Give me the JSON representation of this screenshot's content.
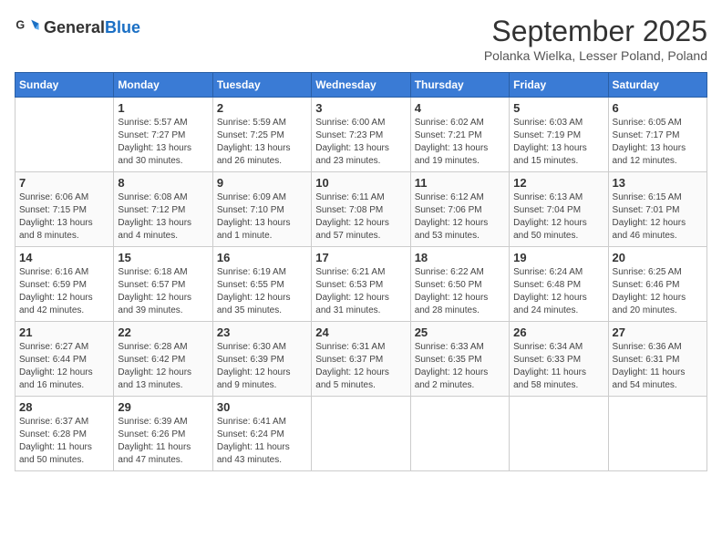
{
  "header": {
    "logo_general": "General",
    "logo_blue": "Blue",
    "month_title": "September 2025",
    "subtitle": "Polanka Wielka, Lesser Poland, Poland"
  },
  "days_of_week": [
    "Sunday",
    "Monday",
    "Tuesday",
    "Wednesday",
    "Thursday",
    "Friday",
    "Saturday"
  ],
  "weeks": [
    [
      {
        "day": "",
        "info": ""
      },
      {
        "day": "1",
        "info": "Sunrise: 5:57 AM\nSunset: 7:27 PM\nDaylight: 13 hours\nand 30 minutes."
      },
      {
        "day": "2",
        "info": "Sunrise: 5:59 AM\nSunset: 7:25 PM\nDaylight: 13 hours\nand 26 minutes."
      },
      {
        "day": "3",
        "info": "Sunrise: 6:00 AM\nSunset: 7:23 PM\nDaylight: 13 hours\nand 23 minutes."
      },
      {
        "day": "4",
        "info": "Sunrise: 6:02 AM\nSunset: 7:21 PM\nDaylight: 13 hours\nand 19 minutes."
      },
      {
        "day": "5",
        "info": "Sunrise: 6:03 AM\nSunset: 7:19 PM\nDaylight: 13 hours\nand 15 minutes."
      },
      {
        "day": "6",
        "info": "Sunrise: 6:05 AM\nSunset: 7:17 PM\nDaylight: 13 hours\nand 12 minutes."
      }
    ],
    [
      {
        "day": "7",
        "info": "Sunrise: 6:06 AM\nSunset: 7:15 PM\nDaylight: 13 hours\nand 8 minutes."
      },
      {
        "day": "8",
        "info": "Sunrise: 6:08 AM\nSunset: 7:12 PM\nDaylight: 13 hours\nand 4 minutes."
      },
      {
        "day": "9",
        "info": "Sunrise: 6:09 AM\nSunset: 7:10 PM\nDaylight: 13 hours\nand 1 minute."
      },
      {
        "day": "10",
        "info": "Sunrise: 6:11 AM\nSunset: 7:08 PM\nDaylight: 12 hours\nand 57 minutes."
      },
      {
        "day": "11",
        "info": "Sunrise: 6:12 AM\nSunset: 7:06 PM\nDaylight: 12 hours\nand 53 minutes."
      },
      {
        "day": "12",
        "info": "Sunrise: 6:13 AM\nSunset: 7:04 PM\nDaylight: 12 hours\nand 50 minutes."
      },
      {
        "day": "13",
        "info": "Sunrise: 6:15 AM\nSunset: 7:01 PM\nDaylight: 12 hours\nand 46 minutes."
      }
    ],
    [
      {
        "day": "14",
        "info": "Sunrise: 6:16 AM\nSunset: 6:59 PM\nDaylight: 12 hours\nand 42 minutes."
      },
      {
        "day": "15",
        "info": "Sunrise: 6:18 AM\nSunset: 6:57 PM\nDaylight: 12 hours\nand 39 minutes."
      },
      {
        "day": "16",
        "info": "Sunrise: 6:19 AM\nSunset: 6:55 PM\nDaylight: 12 hours\nand 35 minutes."
      },
      {
        "day": "17",
        "info": "Sunrise: 6:21 AM\nSunset: 6:53 PM\nDaylight: 12 hours\nand 31 minutes."
      },
      {
        "day": "18",
        "info": "Sunrise: 6:22 AM\nSunset: 6:50 PM\nDaylight: 12 hours\nand 28 minutes."
      },
      {
        "day": "19",
        "info": "Sunrise: 6:24 AM\nSunset: 6:48 PM\nDaylight: 12 hours\nand 24 minutes."
      },
      {
        "day": "20",
        "info": "Sunrise: 6:25 AM\nSunset: 6:46 PM\nDaylight: 12 hours\nand 20 minutes."
      }
    ],
    [
      {
        "day": "21",
        "info": "Sunrise: 6:27 AM\nSunset: 6:44 PM\nDaylight: 12 hours\nand 16 minutes."
      },
      {
        "day": "22",
        "info": "Sunrise: 6:28 AM\nSunset: 6:42 PM\nDaylight: 12 hours\nand 13 minutes."
      },
      {
        "day": "23",
        "info": "Sunrise: 6:30 AM\nSunset: 6:39 PM\nDaylight: 12 hours\nand 9 minutes."
      },
      {
        "day": "24",
        "info": "Sunrise: 6:31 AM\nSunset: 6:37 PM\nDaylight: 12 hours\nand 5 minutes."
      },
      {
        "day": "25",
        "info": "Sunrise: 6:33 AM\nSunset: 6:35 PM\nDaylight: 12 hours\nand 2 minutes."
      },
      {
        "day": "26",
        "info": "Sunrise: 6:34 AM\nSunset: 6:33 PM\nDaylight: 11 hours\nand 58 minutes."
      },
      {
        "day": "27",
        "info": "Sunrise: 6:36 AM\nSunset: 6:31 PM\nDaylight: 11 hours\nand 54 minutes."
      }
    ],
    [
      {
        "day": "28",
        "info": "Sunrise: 6:37 AM\nSunset: 6:28 PM\nDaylight: 11 hours\nand 50 minutes."
      },
      {
        "day": "29",
        "info": "Sunrise: 6:39 AM\nSunset: 6:26 PM\nDaylight: 11 hours\nand 47 minutes."
      },
      {
        "day": "30",
        "info": "Sunrise: 6:41 AM\nSunset: 6:24 PM\nDaylight: 11 hours\nand 43 minutes."
      },
      {
        "day": "",
        "info": ""
      },
      {
        "day": "",
        "info": ""
      },
      {
        "day": "",
        "info": ""
      },
      {
        "day": "",
        "info": ""
      }
    ]
  ]
}
